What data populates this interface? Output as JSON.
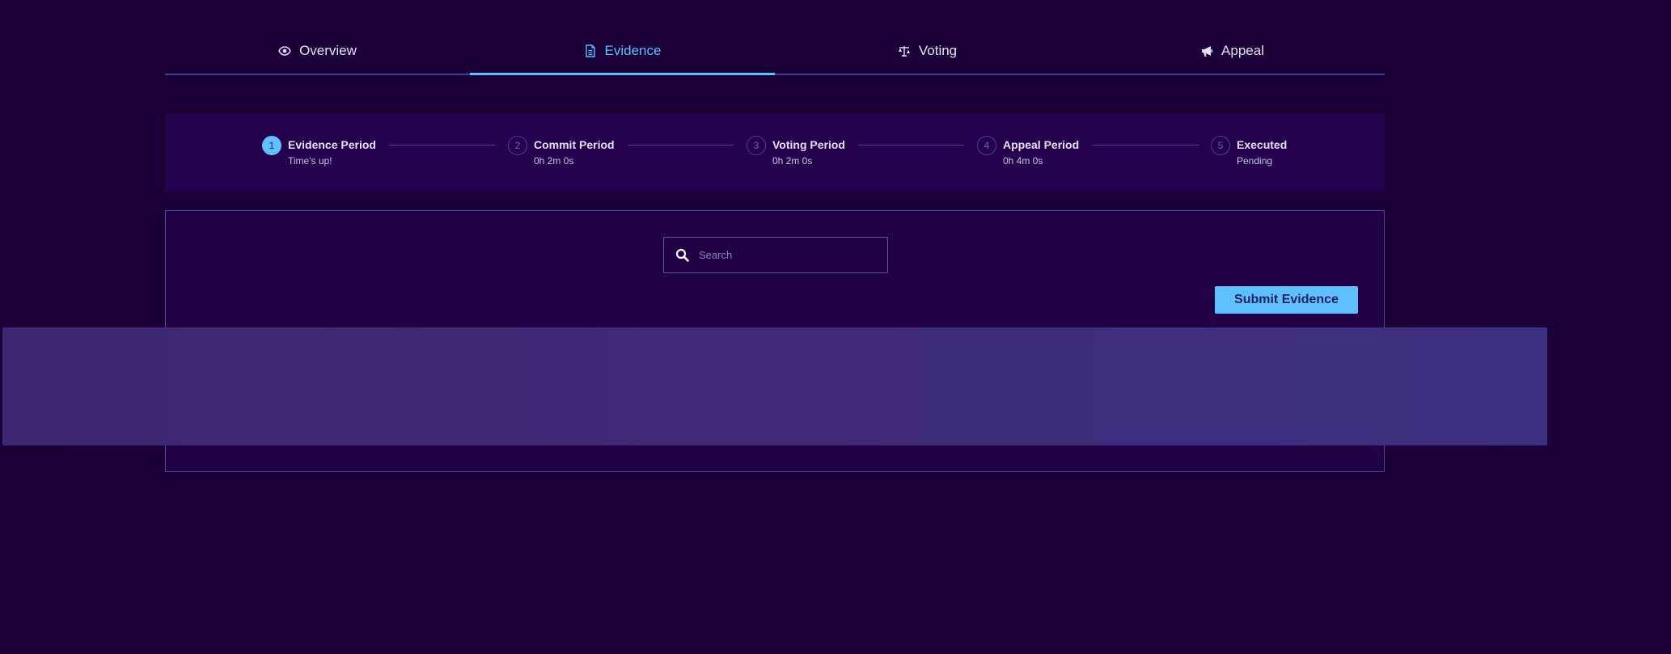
{
  "tabs": [
    {
      "label": "Overview",
      "icon": "eye-icon",
      "active": false
    },
    {
      "label": "Evidence",
      "icon": "document-icon",
      "active": true
    },
    {
      "label": "Voting",
      "icon": "scales-icon",
      "active": false
    },
    {
      "label": "Appeal",
      "icon": "megaphone-icon",
      "active": false
    }
  ],
  "stepper": {
    "steps": [
      {
        "number": "1",
        "title": "Evidence Period",
        "subtitle": "Time's up!",
        "state": "current"
      },
      {
        "number": "2",
        "title": "Commit Period",
        "subtitle": "0h 2m 0s",
        "state": "upcoming"
      },
      {
        "number": "3",
        "title": "Voting Period",
        "subtitle": "0h 2m 0s",
        "state": "upcoming"
      },
      {
        "number": "4",
        "title": "Appeal Period",
        "subtitle": "0h 4m 0s",
        "state": "upcoming"
      },
      {
        "number": "5",
        "title": "Executed",
        "subtitle": "Pending",
        "state": "upcoming"
      }
    ]
  },
  "evidence": {
    "search": {
      "placeholder": "Search",
      "value": "",
      "icon": "search-icon"
    },
    "submit_label": "Submit Evidence"
  },
  "colors": {
    "background": "#1b0038",
    "accent": "#5fc0ff",
    "panel": "#24004d",
    "loading": "#3d2a78"
  }
}
